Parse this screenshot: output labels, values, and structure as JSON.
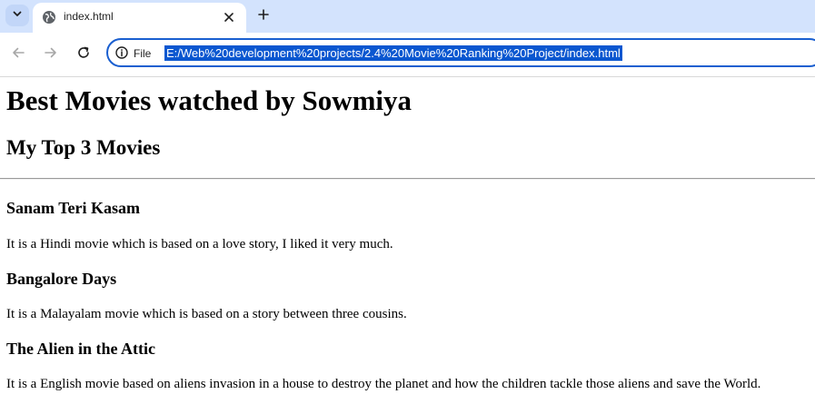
{
  "browser": {
    "tab_title": "index.html",
    "site_info_label": "File",
    "url": "E:/Web%20development%20projects/2.4%20Movie%20Ranking%20Project/index.html"
  },
  "page": {
    "heading": "Best Movies watched by Sowmiya",
    "subheading": "My Top 3 Movies",
    "movies": [
      {
        "title": "Sanam Teri Kasam",
        "description": "It is a Hindi movie which is based on a love story, I liked it very much."
      },
      {
        "title": "Bangalore Days",
        "description": "It is a Malayalam movie which is based on a story between three cousins."
      },
      {
        "title": "The Alien in the Attic",
        "description": "It is a English movie based on aliens invasion in a house to destroy the planet and how the children tackle those aliens and save the World."
      }
    ]
  }
}
